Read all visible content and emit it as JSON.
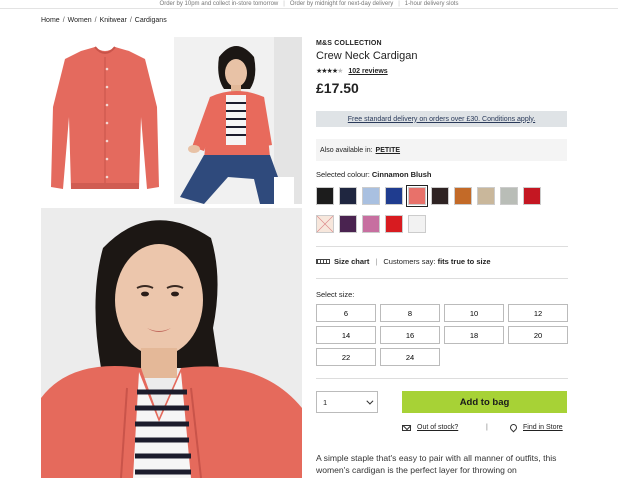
{
  "topbar": {
    "items": [
      "Order by 10pm and collect in-store tomorrow",
      "Order by midnight for next-day delivery",
      "1-hour delivery slots"
    ]
  },
  "breadcrumb": [
    "Home",
    "Women",
    "Knitwear",
    "Cardigans"
  ],
  "product": {
    "brand": "M&S COLLECTION",
    "title": "Crew Neck Cardigan",
    "rating": 4,
    "rating_max": 5,
    "reviews": "102 reviews",
    "price": "£17.50"
  },
  "delivery_banner": "Free standard delivery on orders over £30. Conditions apply.",
  "also_available": {
    "label": "Also available in:",
    "link": "PETITE"
  },
  "colour": {
    "label": "Selected colour:",
    "selected": "Cinnamon Blush",
    "swatches": [
      {
        "color": "#1c1c1c"
      },
      {
        "color": "#1f2640"
      },
      {
        "color": "#a9c0e0"
      },
      {
        "color": "#1f3c8f"
      },
      {
        "color": "#e8716a",
        "selected": true
      },
      {
        "color": "#2e2323"
      },
      {
        "color": "#c36a28"
      },
      {
        "color": "#c9b79b"
      },
      {
        "color": "#b9bdb7"
      },
      {
        "color": "#c41722"
      },
      {
        "color": "#f7e7dc",
        "unavailable": true
      },
      {
        "color": "#4a2350"
      },
      {
        "color": "#c76fa0"
      },
      {
        "color": "#d81b20"
      },
      {
        "color": "#f2f2f2"
      }
    ]
  },
  "size_info": {
    "size_chart": "Size chart",
    "customers_say": "Customers say:",
    "fit": "fits true to size"
  },
  "sizes": {
    "label": "Select size:",
    "options": [
      "6",
      "8",
      "10",
      "12",
      "14",
      "16",
      "18",
      "20",
      "22",
      "24"
    ]
  },
  "purchase": {
    "quantity": "1",
    "add_to_bag": "Add to bag",
    "out_of_stock": "Out of stock?",
    "find_in_store": "Find in Store"
  },
  "description": "A simple staple that's easy to pair with all manner of outfits, this women's cardigan is the perfect layer for throwing on"
}
